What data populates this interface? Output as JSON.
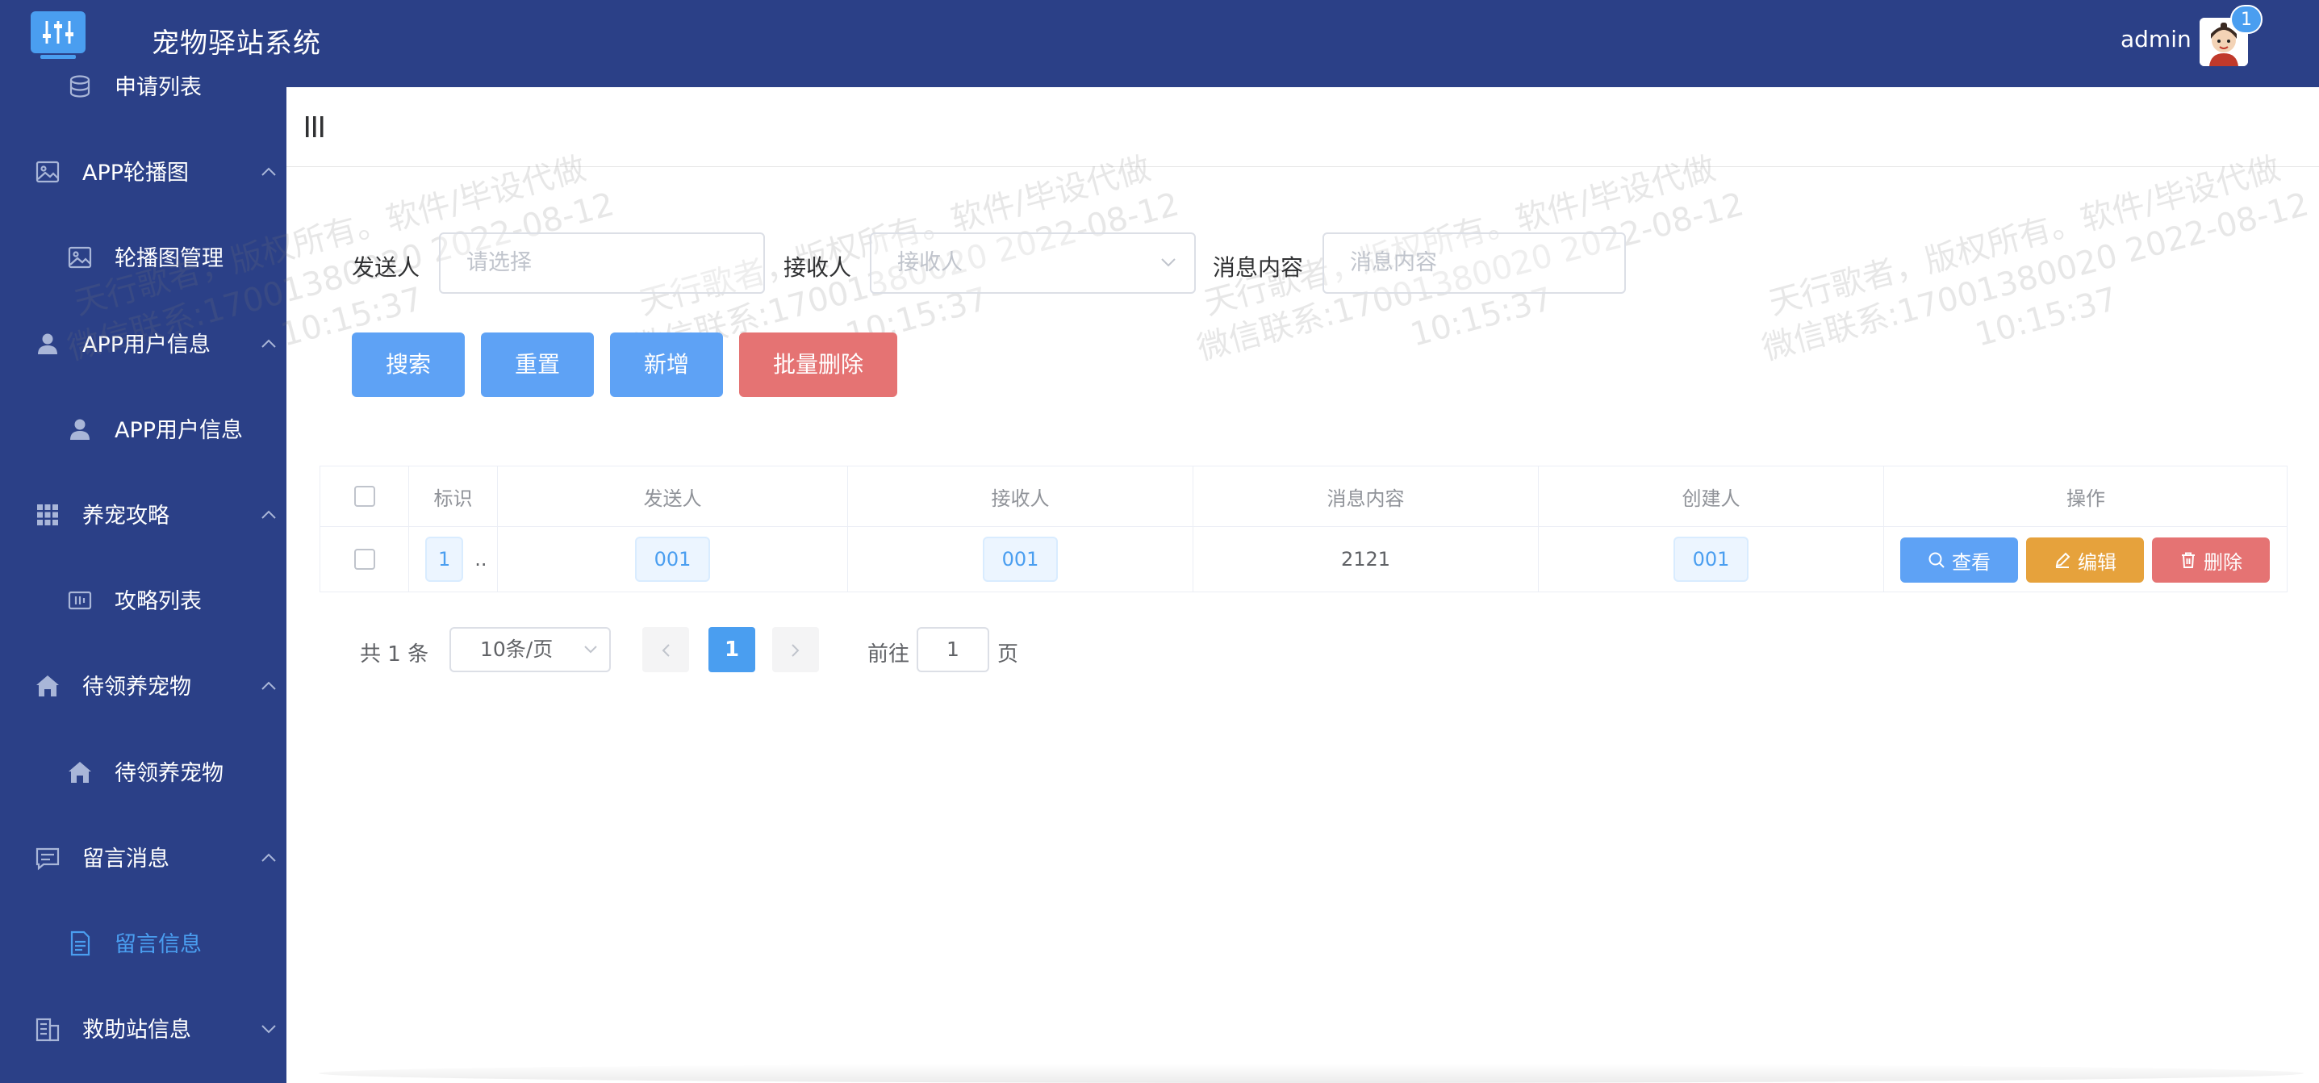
{
  "header": {
    "title": "宠物驿站系统",
    "username": "admin",
    "notification_count": "1"
  },
  "sidebar": {
    "items": [
      {
        "label": "申请列表",
        "level": "sub",
        "icon": "database-icon"
      },
      {
        "label": "APP轮播图",
        "level": "group",
        "icon": "picture-icon"
      },
      {
        "label": "轮播图管理",
        "level": "sub",
        "icon": "picture-icon"
      },
      {
        "label": "APP用户信息",
        "level": "group",
        "icon": "user-icon"
      },
      {
        "label": "APP用户信息",
        "level": "sub",
        "icon": "user-icon"
      },
      {
        "label": "养宠攻略",
        "level": "group",
        "icon": "grid-icon"
      },
      {
        "label": "攻略列表",
        "level": "sub",
        "icon": "tickets-icon"
      },
      {
        "label": "待领养宠物",
        "level": "group",
        "icon": "home-icon"
      },
      {
        "label": "待领养宠物",
        "level": "sub",
        "icon": "home-icon"
      },
      {
        "label": "留言消息",
        "level": "group",
        "icon": "message-icon"
      },
      {
        "label": "留言信息",
        "level": "sub",
        "icon": "document-icon",
        "active": true
      },
      {
        "label": "救助站信息",
        "level": "group",
        "icon": "office-building-icon"
      }
    ],
    "active_color": "#4a9ef0"
  },
  "search": {
    "sender_label": "发送人",
    "sender_placeholder": "请选择",
    "receiver_label": "接收人",
    "receiver_placeholder": "接收人",
    "content_label": "消息内容",
    "content_placeholder": "消息内容",
    "search_button": "搜索",
    "reset_button": "重置",
    "add_button": "新增",
    "batch_delete_button": "批量删除"
  },
  "table": {
    "columns": [
      "标识",
      "发送人",
      "接收人",
      "消息内容",
      "创建人",
      "操作"
    ],
    "rows": [
      {
        "id": "1",
        "id_suffix": "..",
        "sender": "001",
        "receiver": "001",
        "content": "2121",
        "creator": "001"
      }
    ],
    "actions": {
      "view": "查看",
      "edit": "编辑",
      "delete": "删除"
    }
  },
  "pagination": {
    "total_text": "共 1 条",
    "page_size": "10条/页",
    "current_page": "1",
    "goto_label": "前往",
    "goto_value": "1",
    "page_unit": "页"
  },
  "watermark": {
    "line1": "天行歌者，版权所有。软件/毕设代做",
    "line2": "微信联系:17001380020 2022-08-12",
    "line3": "10:15:37"
  },
  "colors": {
    "header_bg": "#2b4087",
    "primary": "#5ea2f5",
    "danger": "#e57373",
    "warning": "#e6a23c"
  }
}
